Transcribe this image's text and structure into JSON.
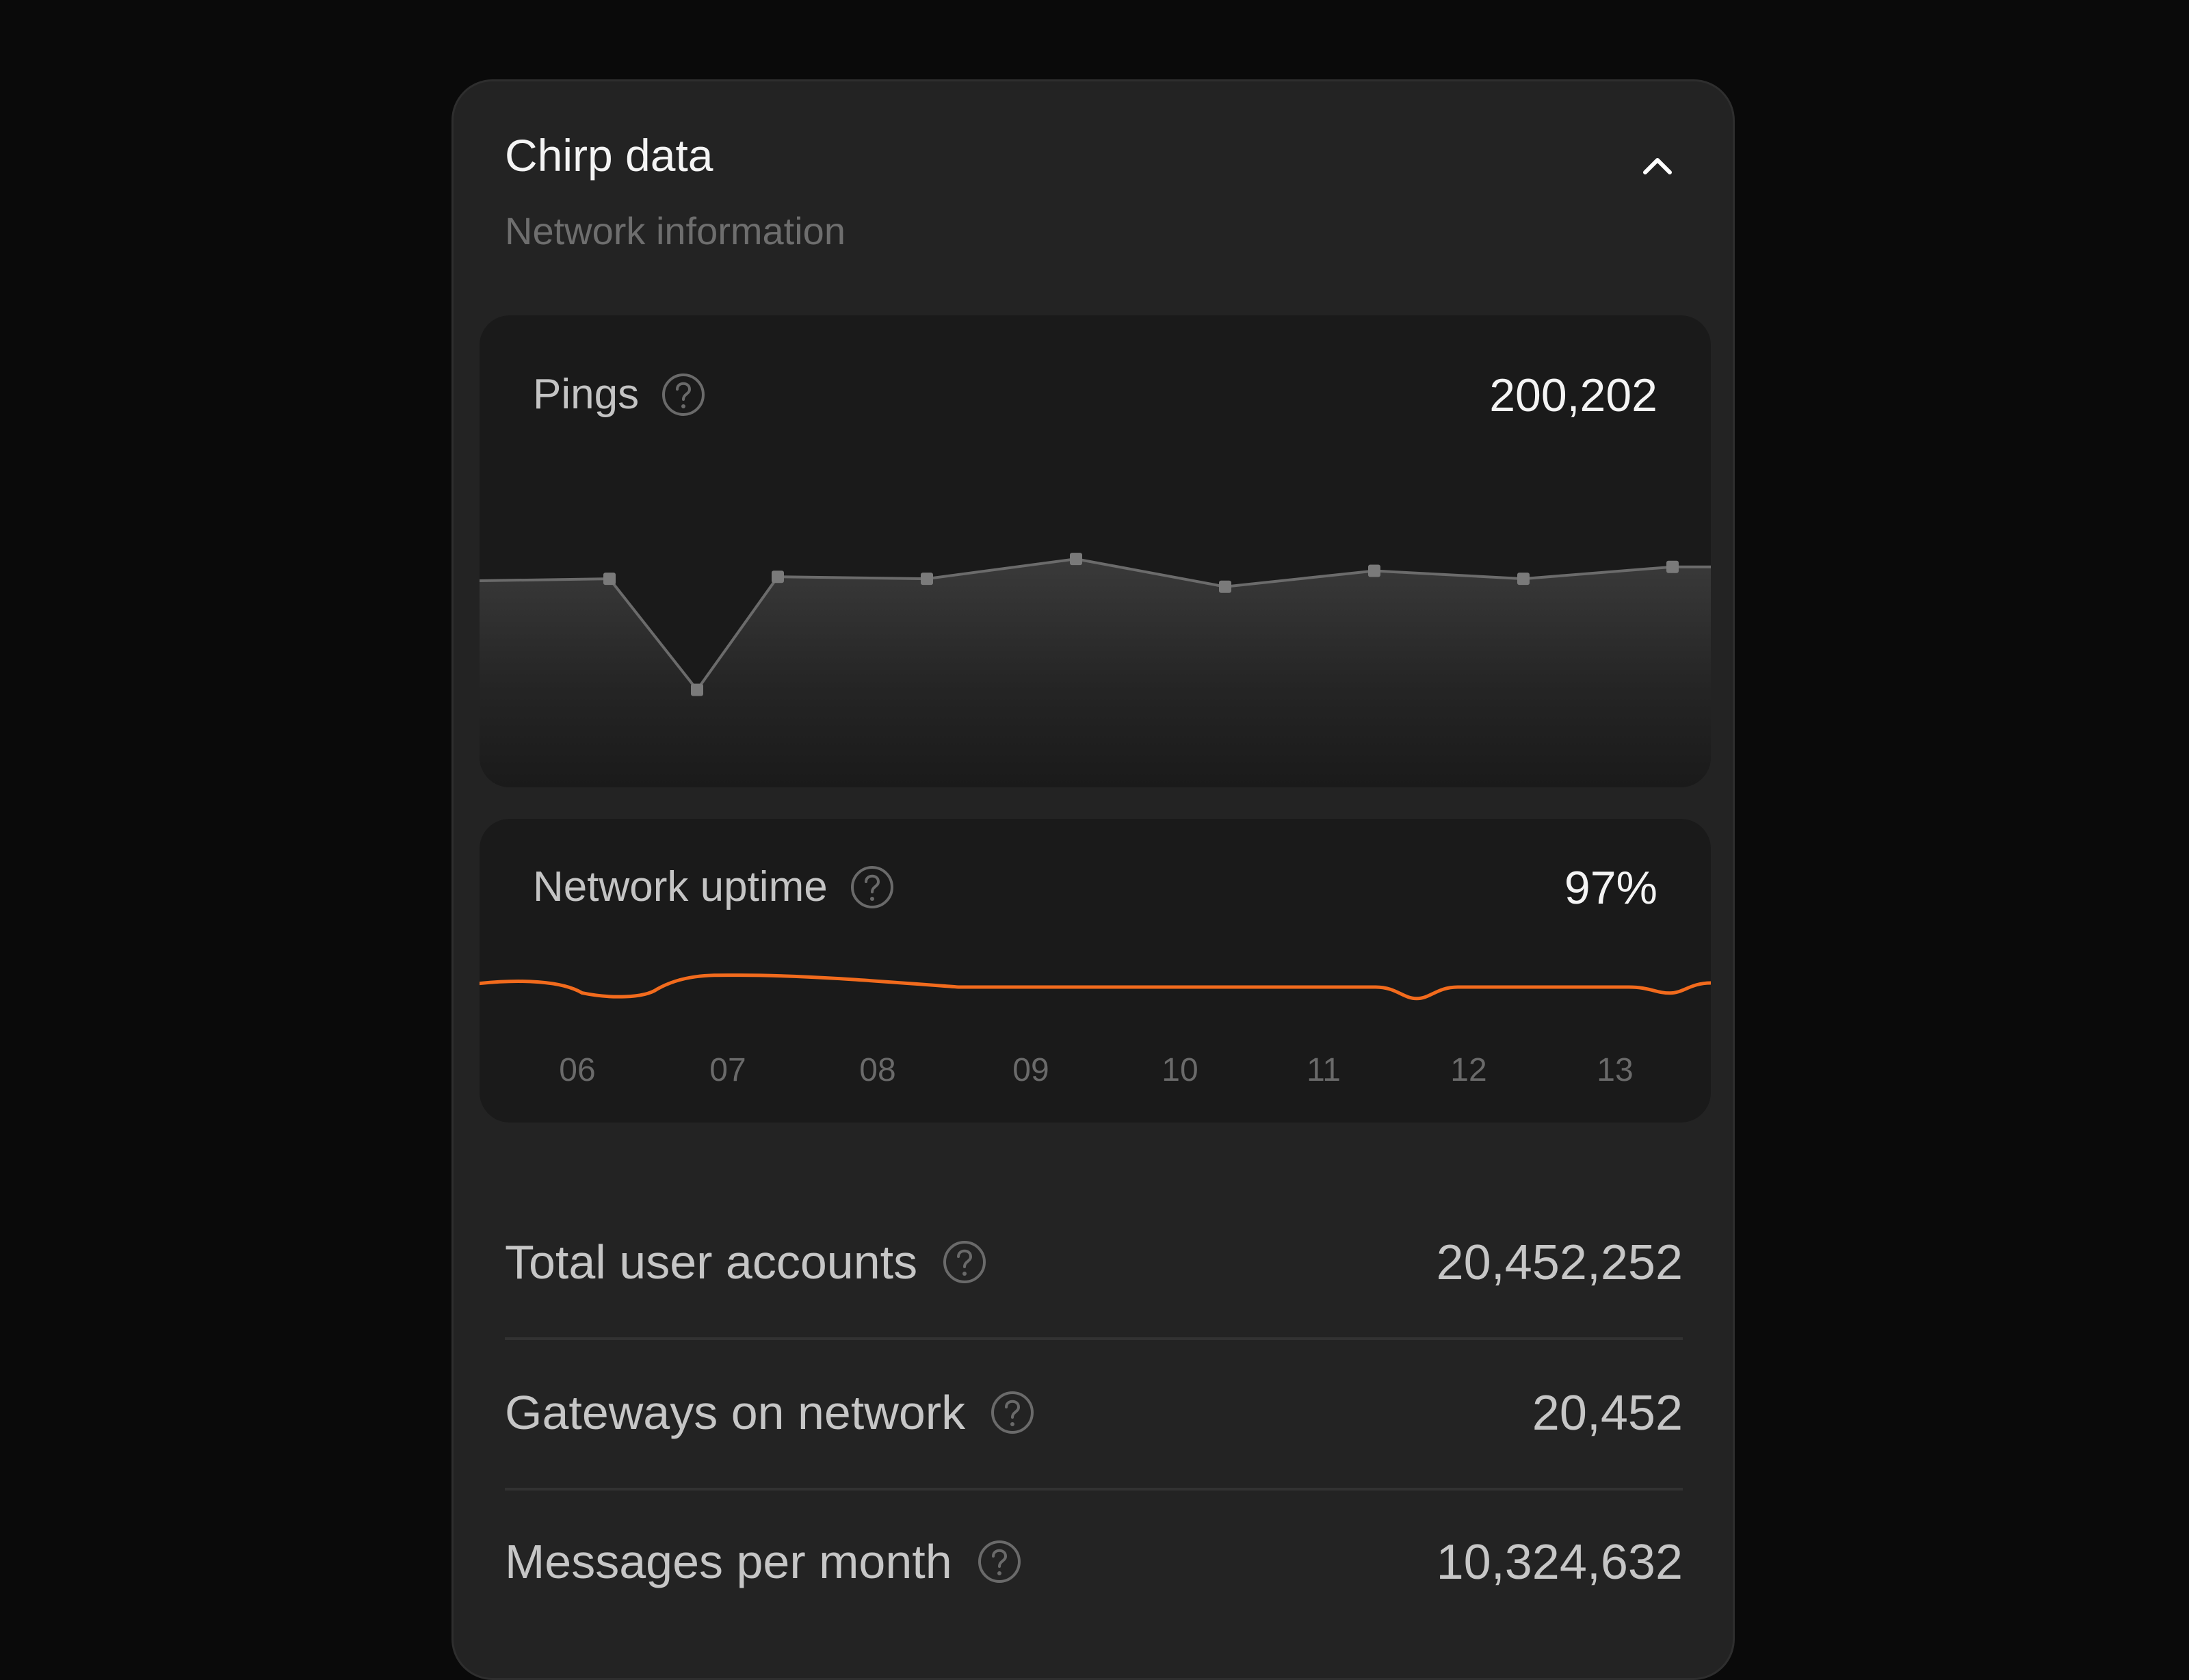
{
  "header": {
    "title": "Chirp data",
    "subtitle": "Network  information"
  },
  "pings": {
    "label": "Pings",
    "value": "200,202"
  },
  "uptime": {
    "label": "Network uptime",
    "value": "97%"
  },
  "stats": [
    {
      "label": "Total user accounts",
      "value": "20,452,252"
    },
    {
      "label": "Gateways on network",
      "value": "20,452"
    },
    {
      "label": "Messages  per month",
      "value": "10,324,632"
    }
  ],
  "icons": {
    "collapse": "chevron-up-icon",
    "help": "question-circle-icon"
  },
  "colors": {
    "accent": "#f26b1d",
    "ping_line": "#6b6b6b",
    "ping_marker": "#7a7a7a"
  },
  "chart_data": [
    {
      "type": "line",
      "series": [
        {
          "values": [
            0.8,
            0.81,
            0.25,
            0.82,
            0.81,
            0.91,
            0.77,
            0.85,
            0.81,
            0.87
          ]
        }
      ],
      "grid": false
    },
    {
      "type": "line",
      "x": [
        "06",
        "07",
        "08",
        "09",
        "10",
        "11",
        "12",
        "13"
      ],
      "series": [
        {
          "values": [
            0.99,
            0.93,
            0.99,
            0.97,
            0.97,
            0.97,
            0.93,
            0.97
          ]
        }
      ],
      "grid": false
    }
  ]
}
